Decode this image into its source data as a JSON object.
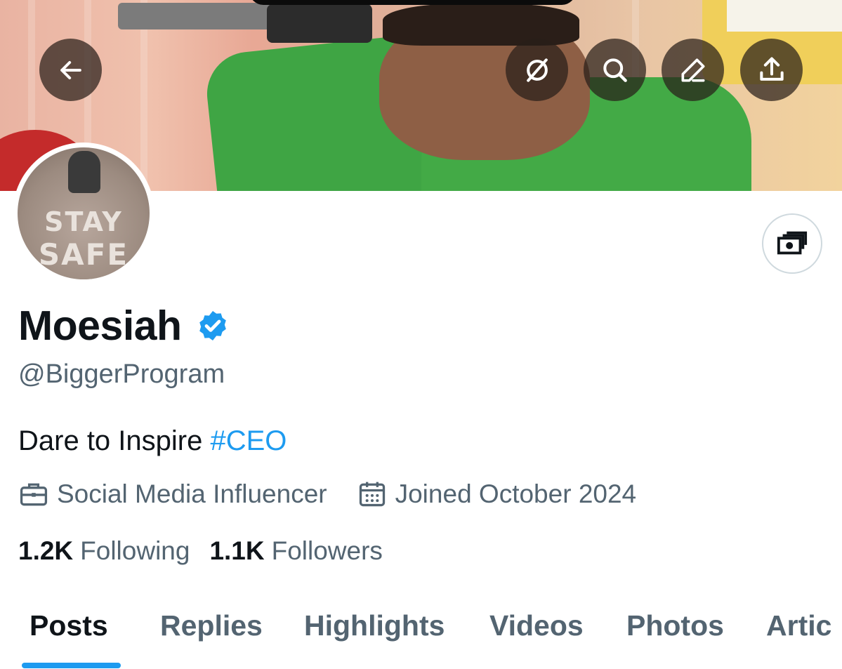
{
  "profile": {
    "name": "Moesiah",
    "handle": "@BiggerProgram",
    "bio_text": "Dare to Inspire ",
    "bio_hashtag": "#CEO",
    "category": "Social Media Influencer",
    "joined": "Joined October 2024",
    "avatar_text_line1": "STAY",
    "avatar_text_line2": "SAFE"
  },
  "stats": {
    "following_count": "1.2K",
    "following_label": "Following",
    "followers_count": "1.1K",
    "followers_label": "Followers"
  },
  "tabs": [
    {
      "label": "Posts",
      "active": true
    },
    {
      "label": "Replies",
      "active": false
    },
    {
      "label": "Highlights",
      "active": false
    },
    {
      "label": "Videos",
      "active": false
    },
    {
      "label": "Photos",
      "active": false
    },
    {
      "label": "Artic",
      "active": false
    }
  ],
  "icons": {
    "back": "arrow-left-icon",
    "grok": "grok-icon",
    "search": "search-icon",
    "edit": "pencil-icon",
    "share": "share-icon",
    "money": "money-icon",
    "verified": "verified-badge-icon",
    "category": "briefcase-icon",
    "joined": "calendar-icon"
  },
  "colors": {
    "accent": "#1d9bf0",
    "text_primary": "#0f1419",
    "text_secondary": "#536471"
  }
}
